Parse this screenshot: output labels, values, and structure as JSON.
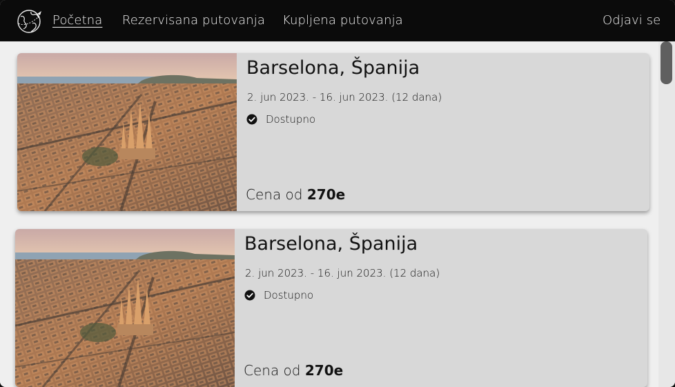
{
  "nav": {
    "logo_icon": "globe-plane-icon",
    "links": [
      {
        "label": "Početna",
        "active": true
      },
      {
        "label": "Rezervisana putovanja",
        "active": false
      },
      {
        "label": "Kupljena putovanja",
        "active": false
      }
    ],
    "logout_label": "Odjavi se"
  },
  "trips": [
    {
      "title": "Barselona, Španija",
      "dates": "2. jun 2023. - 16. jun 2023. (12 dana)",
      "status": "Dostupno",
      "status_icon": "check-circle-icon",
      "price_prefix": "Cena od",
      "price": "270e"
    },
    {
      "title": "Barselona, Španija",
      "dates": "2. jun 2023. - 16. jun 2023. (12 dana)",
      "status": "Dostupno",
      "status_icon": "check-circle-icon",
      "price_prefix": "Cena od",
      "price": "270e"
    }
  ],
  "colors": {
    "navbar_bg": "#0b0b0b",
    "card_bg": "#d8d8d8",
    "page_bg": "#efefef"
  }
}
